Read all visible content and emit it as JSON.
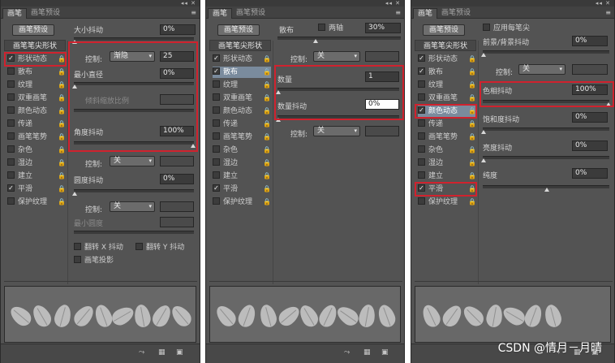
{
  "topbar": "◂◂ ✕",
  "tabs": {
    "brush": "画笔",
    "preset": "画笔预设"
  },
  "menu_icon": "≡",
  "preset_button": "画笔预设",
  "tip_shape": "画笔笔尖形状",
  "items": [
    "形状动态",
    "散布",
    "纹理",
    "双重画笔",
    "颜色动态",
    "传递",
    "画笔笔势",
    "杂色",
    "湿边",
    "建立",
    "平滑",
    "保护纹理"
  ],
  "lock": "🔒",
  "check": "✓",
  "panel1": {
    "size_jitter": "大小抖动",
    "size_jitter_val": "0%",
    "control": "控制:",
    "control_sel": "渐隐",
    "fade_val": "25",
    "min_diameter": "最小直径",
    "min_diameter_val": "0%",
    "tilt_scale": "倾斜缩放比例",
    "angle_jitter": "角度抖动",
    "angle_jitter_val": "100%",
    "control2": "控制:",
    "control2_sel": "关",
    "roundness_jitter": "圆度抖动",
    "roundness_jitter_val": "0%",
    "control3": "控制:",
    "control3_sel": "关",
    "min_roundness": "最小圆度",
    "flip_x": "翻转 X 抖动",
    "flip_y": "翻转 Y 抖动",
    "brush_projection": "画笔投影"
  },
  "panel2": {
    "scatter": "散布",
    "both_axes": "两轴",
    "scatter_val": "30%",
    "control": "控制:",
    "control_sel": "关",
    "count": "数量",
    "count_val": "1",
    "count_jitter": "数量抖动",
    "count_jitter_val": "0%",
    "control2": "控制:",
    "control2_sel": "关"
  },
  "panel3": {
    "apply_per_tip": "应用每笔尖",
    "fg_bg_jitter": "前景/背景抖动",
    "fg_bg_val": "0%",
    "control": "控制:",
    "control_sel": "关",
    "hue_jitter": "色相抖动",
    "hue_val": "100%",
    "sat_jitter": "饱和度抖动",
    "sat_val": "0%",
    "bright_jitter": "亮度抖动",
    "bright_val": "0%",
    "purity": "纯度",
    "purity_val": "0%"
  },
  "bottom_icons": [
    "⤳",
    "▦",
    "▣"
  ],
  "watermark": "CSDN @情月－月晴"
}
